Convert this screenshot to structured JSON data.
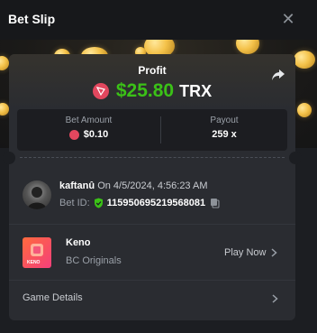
{
  "header": {
    "title": "Bet Slip",
    "close_icon": "close-icon"
  },
  "profit": {
    "label": "Profit",
    "amount": "$25.80",
    "currency": "TRX",
    "amount_color": "#3bc117",
    "coin_color": "#e2475e"
  },
  "stats": {
    "bet_amount_label": "Bet Amount",
    "bet_amount_value": "$0.10",
    "payout_label": "Payout",
    "payout_value": "259 x"
  },
  "bet": {
    "username": "kaftanû",
    "datetime": "On 4/5/2024, 4:56:23 AM",
    "bet_id_label": "Bet ID:",
    "bet_id": "115950695219568081"
  },
  "game": {
    "name": "Keno",
    "provider": "BC Originals",
    "play_label": "Play Now",
    "thumb_text": "KENO"
  },
  "details": {
    "label": "Game Details"
  }
}
